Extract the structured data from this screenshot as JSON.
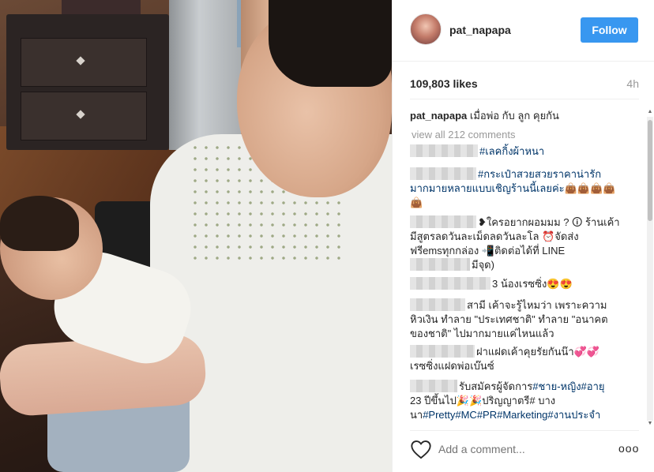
{
  "post": {
    "username": "pat_napapa",
    "follow_label": "Follow",
    "likes": "109,803 likes",
    "time": "4h",
    "caption_user": "pat_napapa",
    "caption_text": "เมื่อพ่อ กับ ลูก คุยกัน",
    "view_all": "view all 212 comments"
  },
  "comments": [
    {
      "text_a": "#เลคกิ้งผ้าหนา"
    },
    {
      "text_a": "#กระเป๋าสวยสวยราคาน่ารัก",
      "text_b": "มากมายหลายแบบเชิญร้านนี้เลยค่ะ👜👜👜👜",
      "text_c": "👜"
    },
    {
      "text_a": "❥ใครอยากผอมมม ? 🛈 ร้านเค้า",
      "text_b": "มีสูตรลดวันละเม็ดลดวันละโล ⏰จัดส่ง",
      "text_c": "ฟรีemsทุกกล่อง 📲ติดต่อได้ที่ LINE",
      "text_d": "มีจุด)"
    },
    {
      "text_a": "3 น้องเรซซิ่ง😍😍"
    },
    {
      "text_a": "สามี เค้าจะรู้ไหมว่า เพราะความ",
      "text_b": "หิวเงิน ทำลาย \"ประเทศชาติ\" ทำลาย \"อนาคต",
      "text_c": "ของชาติ\" ไปมากมายแค่ไหนแล้ว"
    },
    {
      "text_a": "ฝาแฝดเค้าคุยรัยกันน๊า💞💞",
      "text_b": "เรซซิ่งแฝดพ่อเบ๊นซ์"
    },
    {
      "text_a": "รับสมัครผู้จัดการ",
      "tag1": "#ชาย-หญิง#อายุ",
      "text_b": "23 ปีขึ้นไป🎉🎉ปริญญาตรี# บาง",
      "text_c_pre": "นา",
      "tag2": "#Pretty#MC#PR#Marketing#งานประจำ"
    }
  ],
  "footer": {
    "add_comment_placeholder": "Add a comment...",
    "more_label": "ooo"
  },
  "icons": {
    "heart": "heart-icon",
    "more": "more-options-icon"
  },
  "colors": {
    "follow_bg": "#3897f0",
    "hashtag": "#003569",
    "muted": "#999999"
  }
}
